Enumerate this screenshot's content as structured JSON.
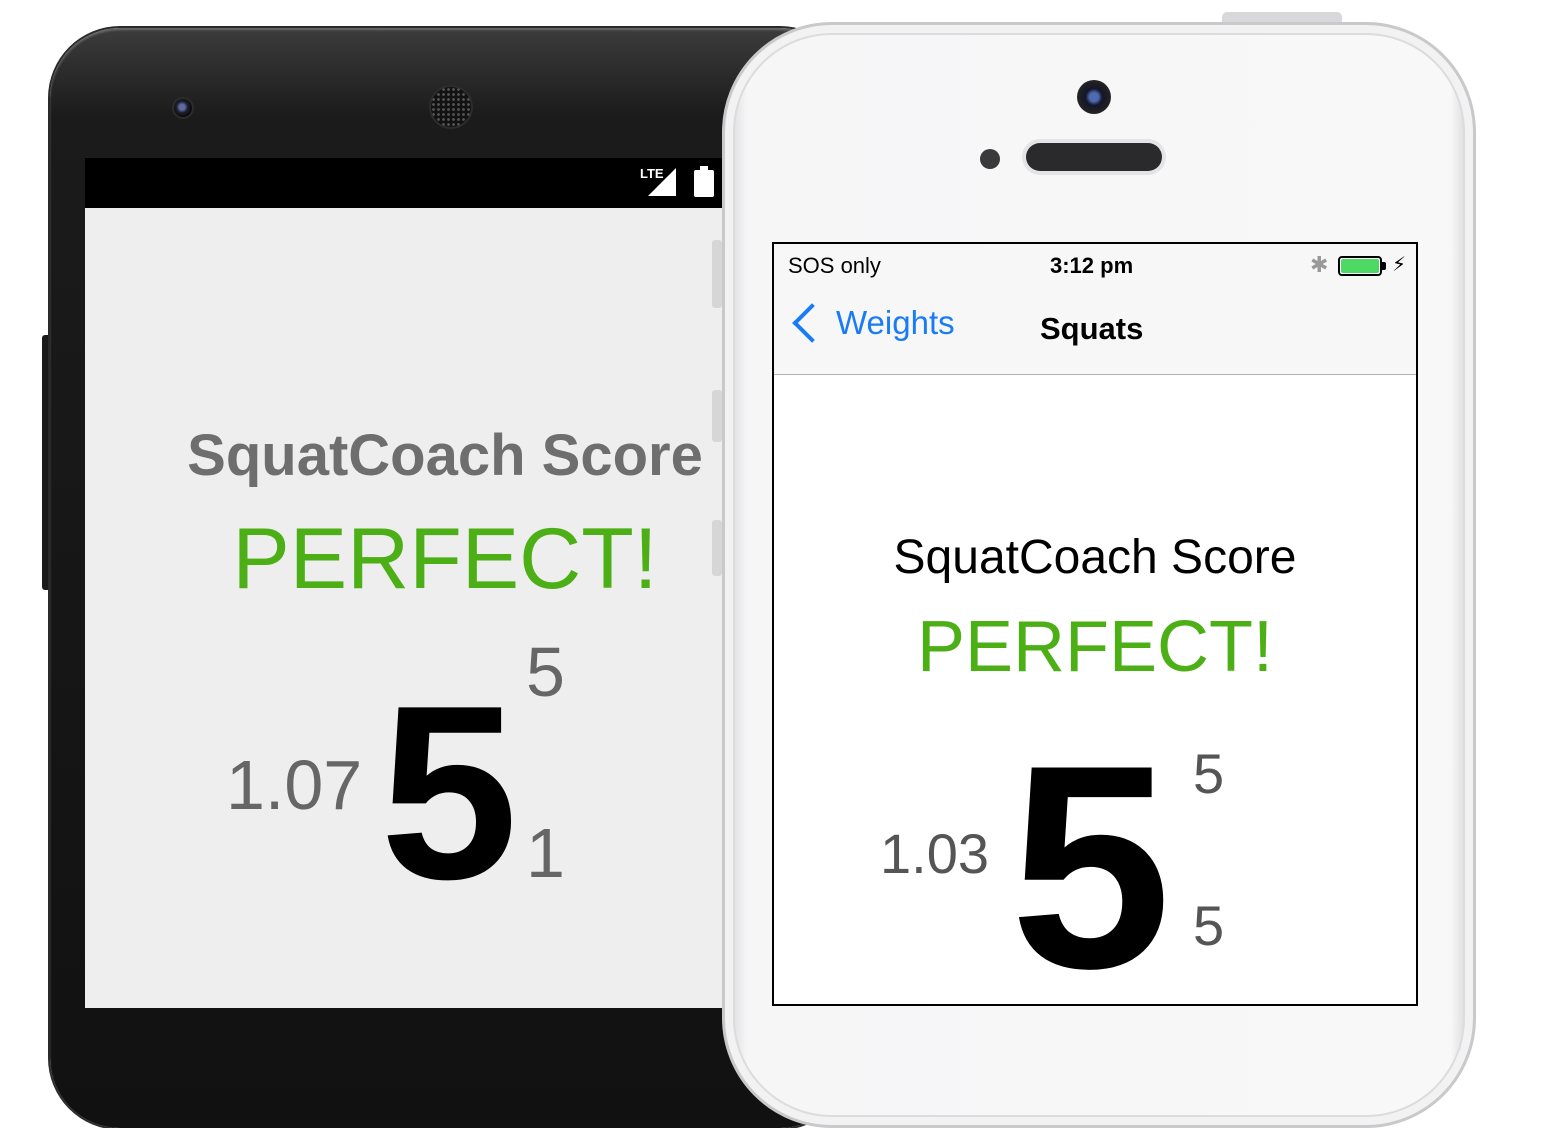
{
  "android": {
    "status": {
      "network": "LTE"
    },
    "title": "SquatCoach Score",
    "rating": "PERFECT!",
    "score": "5",
    "left_value": "1.07",
    "top_value": "5",
    "bottom_value": "1"
  },
  "ios": {
    "status": {
      "carrier": "SOS only",
      "time": "3:12 pm",
      "bluetooth_icon": "bluetooth-icon",
      "battery_level": 1.0,
      "charging_icon": "lightning-icon"
    },
    "nav": {
      "back_label": "Weights",
      "title": "Squats"
    },
    "title": "SquatCoach Score",
    "rating": "PERFECT!",
    "score": "5",
    "left_value": "1.03",
    "top_value": "5",
    "bottom_value": "5"
  },
  "colors": {
    "perfect_green": "#4caf15",
    "ios_blue": "#1a7cf5",
    "battery_green": "#4cd964"
  }
}
